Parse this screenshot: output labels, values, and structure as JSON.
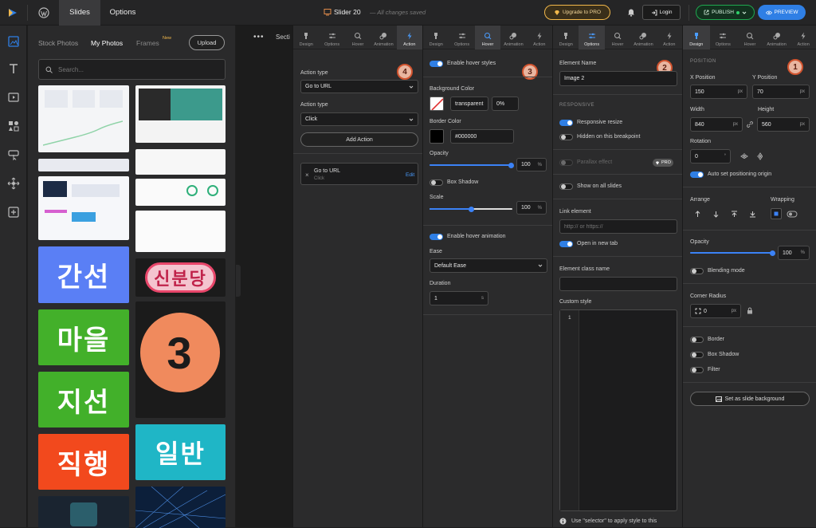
{
  "topbar": {
    "tab_slides": "Slides",
    "tab_options": "Options",
    "title": "Slider 20",
    "save_status": "— All changes saved",
    "upgrade": "Upgrade to PRO",
    "login": "Login",
    "publish": "PUBLISH",
    "preview": "PREVIEW"
  },
  "media": {
    "tab_stock": "Stock Photos",
    "tab_my": "My Photos",
    "tab_frames": "Frames",
    "frames_badge": "New",
    "upload": "Upload",
    "search_placeholder": "Search...",
    "tile_1": "간선",
    "tile_2": "마을",
    "tile_3": "지선",
    "tile_4": "직행",
    "tile_5": "신분당",
    "tile_6": "일반",
    "tile_7": "3"
  },
  "canvas": {
    "section_label": "Secti"
  },
  "tabs": {
    "design": "Design",
    "options": "Options",
    "hover": "Hover",
    "animation": "Animation",
    "action": "Action"
  },
  "action_panel": {
    "badge": "4",
    "type_label_1": "Action type",
    "type_value_1": "Go to URL",
    "type_label_2": "Action type",
    "type_value_2": "Click",
    "add_action": "Add Action",
    "item_title": "Go to URL",
    "item_sub": "Click",
    "item_edit": "Edit"
  },
  "hover_panel": {
    "badge": "3",
    "enable_hover_styles": "Enable hover styles",
    "bg_color_label": "Background Color",
    "bg_color_value": "transparent",
    "bg_opacity": "0%",
    "border_color_label": "Border Color",
    "border_color_value": "#000000",
    "opacity_label": "Opacity",
    "opacity_value": "100",
    "opacity_unit": "%",
    "opacity_fraction": 1.0,
    "box_shadow": "Box Shadow",
    "scale_label": "Scale",
    "scale_value": "100",
    "scale_unit": "%",
    "scale_fraction": 0.5,
    "enable_hover_anim": "Enable hover animation",
    "ease_label": "Ease",
    "ease_value": "Default Ease",
    "duration_label": "Duration",
    "duration_value": "1",
    "duration_unit": "s"
  },
  "options_panel": {
    "badge": "2",
    "element_name_label": "Element Name",
    "element_name_value": "Image 2",
    "responsive_label": "RESPONSIVE",
    "responsive_resize": "Responsive resize",
    "hidden_breakpoint": "Hidden on this breakpoint",
    "parallax": "Parallax effect",
    "pro_badge": "PRO",
    "show_all_slides": "Show on all slides",
    "link_label": "Link element",
    "link_placeholder": "http:// or https://",
    "open_new_tab": "Open in new tab",
    "class_label": "Element class name",
    "custom_style_label": "Custom style",
    "line_number": "1",
    "hint": "Use \"selector\" to apply style to this"
  },
  "design_panel": {
    "badge": "1",
    "position_label": "POSITION",
    "x_label": "X Position",
    "x_value": "150",
    "y_label": "Y Position",
    "y_value": "70",
    "unit_px": "px",
    "width_label": "Width",
    "width_value": "840",
    "height_label": "Height",
    "height_value": "560",
    "rotation_label": "Rotation",
    "rotation_value": "0",
    "rotation_unit": "°",
    "auto_origin": "Auto set positioning origin",
    "arrange_label": "Arrange",
    "wrapping_label": "Wrapping",
    "opacity_label": "Opacity",
    "opacity_value": "100",
    "opacity_unit": "%",
    "opacity_fraction": 1.0,
    "blending": "Blending mode",
    "corner_label": "Corner Radius",
    "corner_value": "0",
    "border": "Border",
    "box_shadow": "Box Shadow",
    "filter": "Filter",
    "set_bg": "Set as slide background"
  },
  "colors": {
    "accent_blue": "#2f7fe5",
    "publish_green": "#1fa84f",
    "upgrade_gold": "#f2b84b",
    "badge_red": "#d2542f"
  }
}
